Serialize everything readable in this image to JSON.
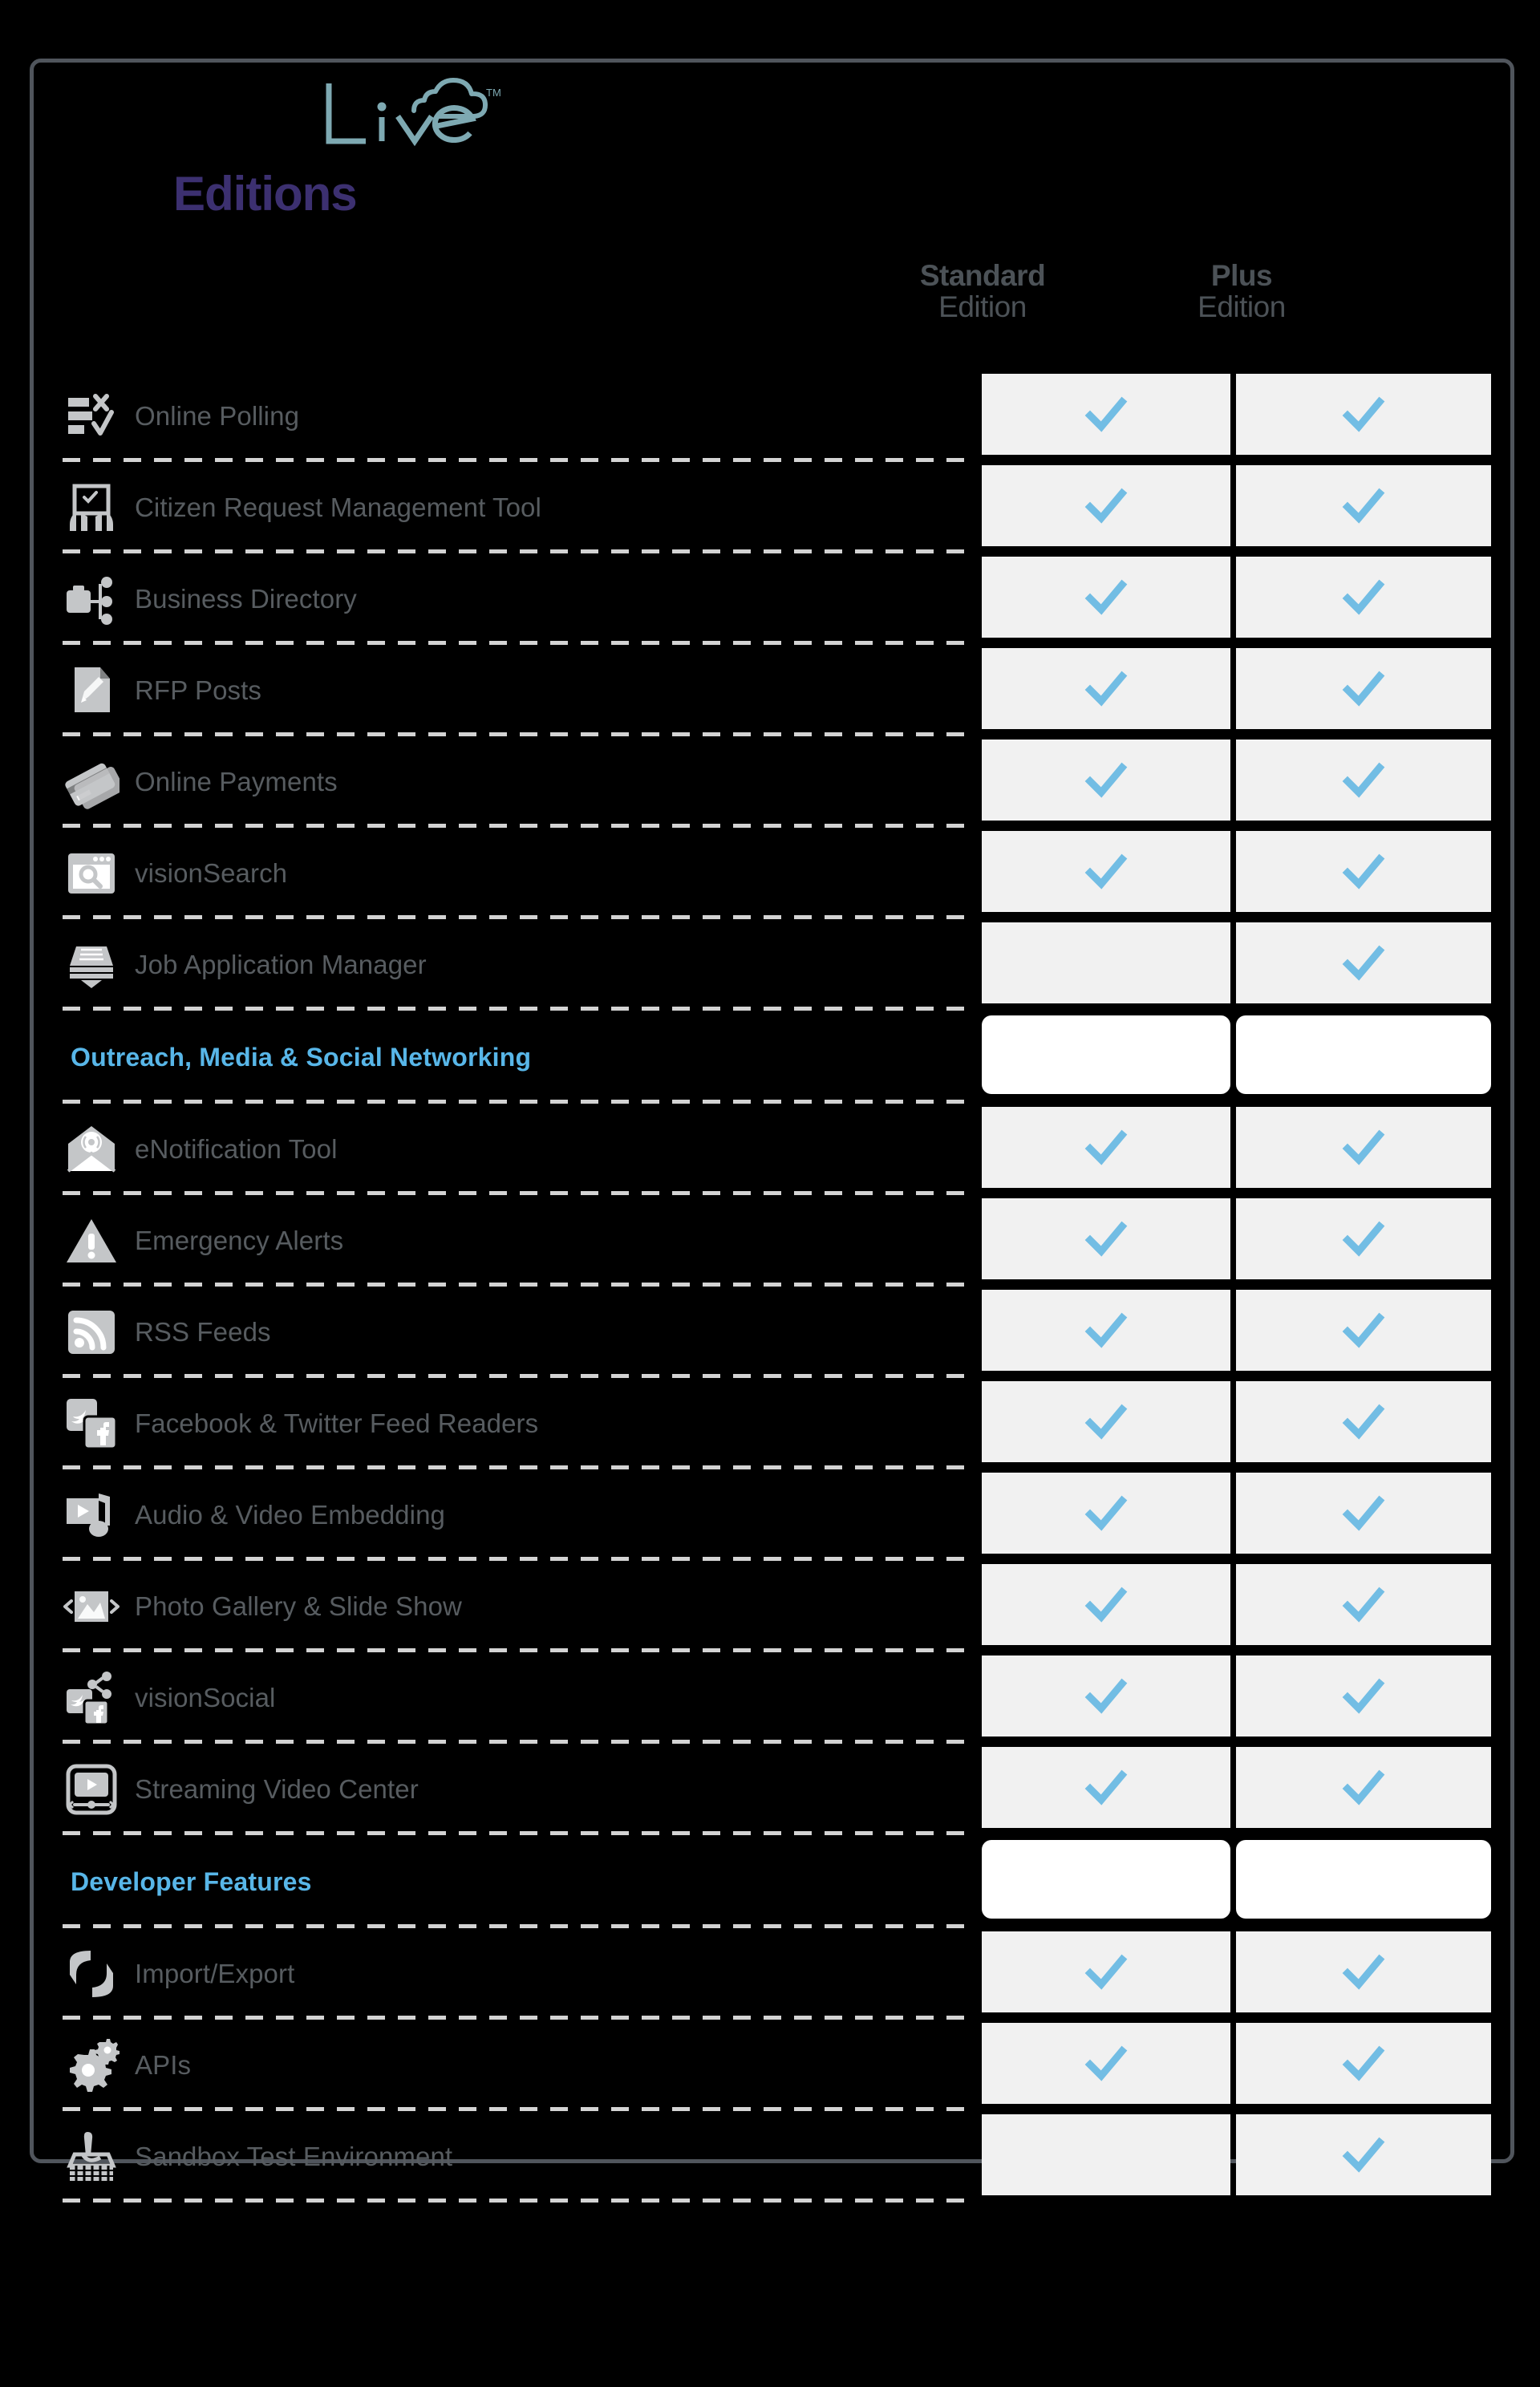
{
  "brand": {
    "logo_text": "Live",
    "logo_trademark": "TM",
    "logo_icon": "cloud-icon",
    "logo_color": "#7ea9b2"
  },
  "page_title": "Editions",
  "page_title_color": "#3c3070",
  "columns": [
    {
      "name": "standard",
      "line1": "Standard",
      "line2": "Edition"
    },
    {
      "name": "plus",
      "line1": "Plus",
      "line2": "Edition"
    }
  ],
  "colors": {
    "check": "#72bde4",
    "section_header": "#58b6e8",
    "cell_bg": "#f1f1f1",
    "section_cell_bg": "#ffffff",
    "label_text": "#575c60",
    "column_header_text": "#4c5257",
    "icon": "#c4c6c8",
    "border": "#50555c",
    "background": "#000000",
    "divider": "#d3d3d3"
  },
  "rows": [
    {
      "type": "feature",
      "icon": "online-polling-icon",
      "label": "Online Polling",
      "standard": true,
      "plus": true
    },
    {
      "type": "feature",
      "icon": "citizen-request-icon",
      "label": "Citizen Request Management Tool",
      "standard": true,
      "plus": true
    },
    {
      "type": "feature",
      "icon": "business-directory-icon",
      "label": "Business Directory",
      "standard": true,
      "plus": true
    },
    {
      "type": "feature",
      "icon": "rfp-posts-icon",
      "label": "RFP Posts",
      "standard": true,
      "plus": true
    },
    {
      "type": "feature",
      "icon": "online-payments-icon",
      "label": "Online Payments",
      "standard": true,
      "plus": true
    },
    {
      "type": "feature",
      "icon": "vision-search-icon",
      "label": "visionSearch",
      "standard": true,
      "plus": true
    },
    {
      "type": "feature",
      "icon": "job-application-icon",
      "label": "Job Application Manager",
      "standard": false,
      "plus": true
    },
    {
      "type": "section",
      "label": "Outreach, Media & Social Networking"
    },
    {
      "type": "feature",
      "icon": "enotification-icon",
      "label": "eNotification Tool",
      "standard": true,
      "plus": true
    },
    {
      "type": "feature",
      "icon": "emergency-alerts-icon",
      "label": "Emergency Alerts",
      "standard": true,
      "plus": true
    },
    {
      "type": "feature",
      "icon": "rss-feeds-icon",
      "label": "RSS Feeds",
      "standard": true,
      "plus": true
    },
    {
      "type": "feature",
      "icon": "social-feed-readers-icon",
      "label": "Facebook & Twitter Feed Readers",
      "standard": true,
      "plus": true
    },
    {
      "type": "feature",
      "icon": "audio-video-icon",
      "label": "Audio & Video Embedding",
      "standard": true,
      "plus": true
    },
    {
      "type": "feature",
      "icon": "photo-gallery-icon",
      "label": "Photo Gallery & Slide Show",
      "standard": true,
      "plus": true
    },
    {
      "type": "feature",
      "icon": "vision-social-icon",
      "label": "visionSocial",
      "standard": true,
      "plus": true
    },
    {
      "type": "feature",
      "icon": "streaming-video-icon",
      "label": "Streaming Video Center",
      "standard": true,
      "plus": true
    },
    {
      "type": "section",
      "label": "Developer Features"
    },
    {
      "type": "feature",
      "icon": "import-export-icon",
      "label": "Import/Export",
      "standard": true,
      "plus": true
    },
    {
      "type": "feature",
      "icon": "apis-icon",
      "label": "APIs",
      "standard": true,
      "plus": true
    },
    {
      "type": "feature",
      "icon": "sandbox-icon",
      "label": "Sandbox Test Environment",
      "standard": false,
      "plus": true
    }
  ]
}
